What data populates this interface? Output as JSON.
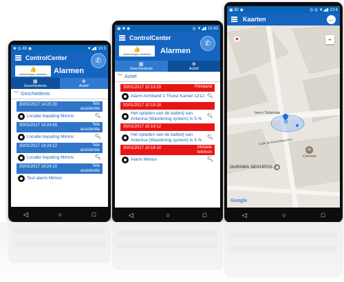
{
  "status": {
    "phone1_left": "❀ ◎ 83 ◉",
    "phone1_right": "▼◢▮ 10:3",
    "phone2_left": "▣ ❀ ◉",
    "phone2_right": "◎ ▼◢▮ 10:40",
    "phone3_left": "▣ 82 ◉",
    "phone3_right": "◎ ◎ ▼◢▮ 10:4"
  },
  "phone1": {
    "app_title": "ControlCenter",
    "alarm_off_label": "Alarmeringen uitzetten",
    "subtitle": "Alarmen",
    "tabs": [
      {
        "label": "Geschiedenis",
        "icon": "calendar-icon"
      },
      {
        "label": "Actief",
        "icon": "plus-circle-icon"
      }
    ],
    "section_title": "Geschiedenis",
    "cards": [
      {
        "time": "30/01/2017 14:25:30",
        "kind_line1": "Tele",
        "kind_line2": "assistentie",
        "text": "Locatie bepaling Mimov"
      },
      {
        "time": "30/01/2017 14:24:55",
        "kind_line1": "Tele",
        "kind_line2": "assistentie",
        "text": "Locatie bepaling Mimov"
      },
      {
        "time": "30/01/2017 14:24:22",
        "kind_line1": "Tele",
        "kind_line2": "assistentie",
        "text": "Locatie bepaling Mimov"
      },
      {
        "time": "30/01/2017 14:24:10",
        "kind_line1": "Tele",
        "kind_line2": "assistentie",
        "text": "Test alarm Mimov"
      }
    ]
  },
  "phone2": {
    "app_title": "ControlCenter",
    "alarm_off_label": "Alarmeringen uitzetten",
    "subtitle": "Alarmen",
    "tabs": [
      {
        "label": "Geschiedenis",
        "icon": "calendar-icon"
      },
      {
        "label": "Actief",
        "icon": "plus-circle-icon"
      }
    ],
    "section_title": "Actief",
    "cards": [
      {
        "time": "30/01/2017 10:19:29",
        "kind_line1": "Polsband",
        "kind_line2": "",
        "text": "Alarm Armband 1 Thuis/ Kamer 1212"
      },
      {
        "time": "30/01/2017 10:19:18",
        "kind_line1": "",
        "kind_line2": "",
        "text": "Het opladen van de batterij van Antenna (Wandering system) is 5 %"
      },
      {
        "time": "30/01/2017 10:19:12",
        "kind_line1": "",
        "kind_line2": "",
        "text": "Het opladen van de batterij van Antenna (Wandering system) is 5 %"
      },
      {
        "time": "30/01/2017 10:16:10",
        "kind_line1": "Mobiele",
        "kind_line2": "telefoon",
        "text": "Alarm Mimov"
      }
    ]
  },
  "phone3": {
    "app_title": "Kaarten",
    "map_labels": {
      "place1": "Iseco Sistemas",
      "street": "Calle de Rosa Mara Roo",
      "post": "Correos",
      "insurance": "OUPAMA SEGUROS",
      "google": "Google"
    }
  },
  "colors": {
    "primary": "#1565c0",
    "history_card": "#2f75c8",
    "alarm_card": "#e81515",
    "map_bg": "#e9e6e0"
  }
}
